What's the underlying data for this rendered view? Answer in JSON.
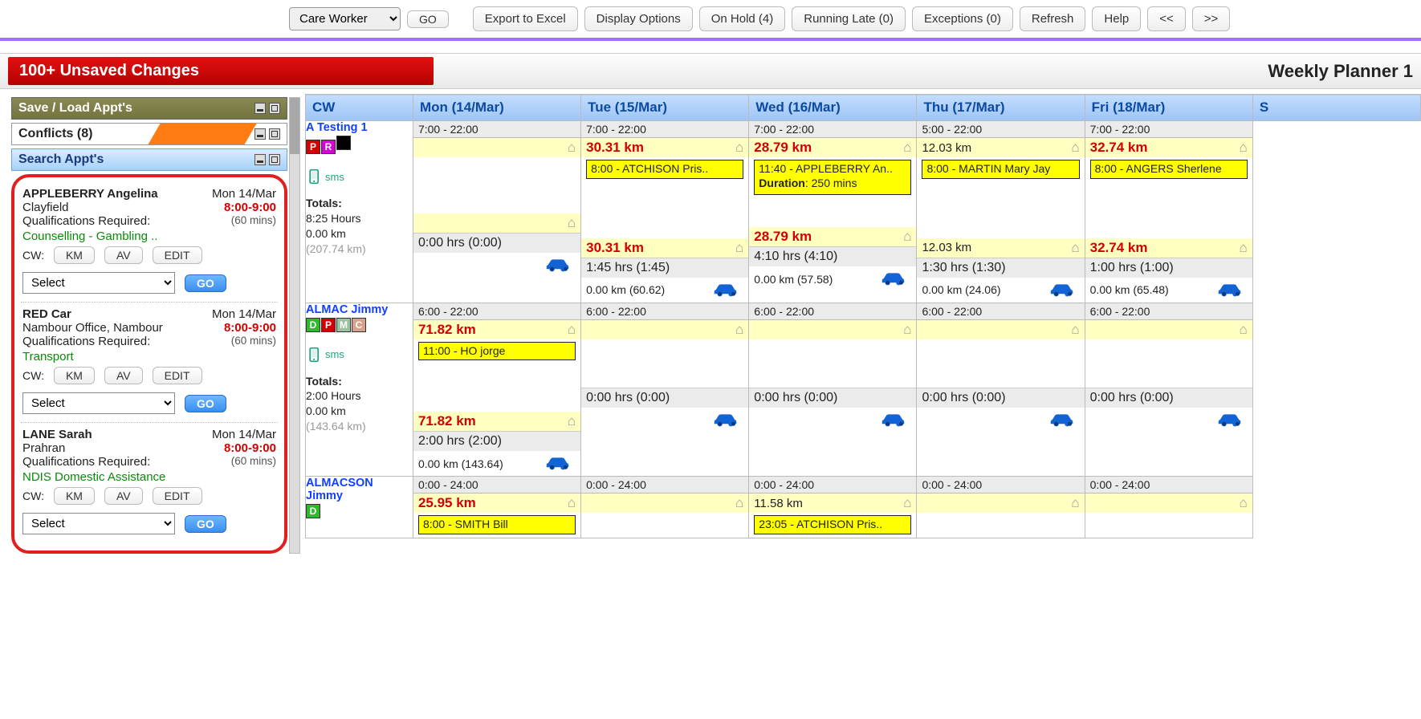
{
  "toolbar": {
    "filter_select": "Care Worker",
    "go": "GO",
    "export": "Export to Excel",
    "display_options": "Display Options",
    "on_hold": "On Hold (4)",
    "running_late": "Running Late (0)",
    "exceptions": "Exceptions (0)",
    "refresh": "Refresh",
    "help": "Help",
    "prev": "<<",
    "next": ">>"
  },
  "banner": "100+ Unsaved Changes",
  "page_title": "Weekly Planner   1",
  "panels": {
    "save_load": "Save / Load Appt's",
    "conflicts": "Conflicts (8)",
    "search": "Search Appt's"
  },
  "cards": [
    {
      "name": "APPLEBERRY Angelina",
      "date": "Mon 14/Mar",
      "loc": "Clayfield",
      "time": "8:00-9:00",
      "qual": "Qualifications Required:",
      "dur": "(60 mins)",
      "service": "Counselling - Gambling ..",
      "cw": "CW:",
      "km": "KM",
      "av": "AV",
      "edit": "EDIT",
      "select": "Select",
      "go": "GO"
    },
    {
      "name": "RED Car",
      "date": "Mon 14/Mar",
      "loc": "Nambour Office, Nambour",
      "time": "8:00-9:00",
      "qual": "Qualifications Required:",
      "dur": "(60 mins)",
      "service": "Transport",
      "cw": "CW:",
      "km": "KM",
      "av": "AV",
      "edit": "EDIT",
      "select": "Select",
      "go": "GO"
    },
    {
      "name": "LANE Sarah",
      "date": "Mon 14/Mar",
      "loc": "Prahran",
      "time": "8:00-9:00",
      "qual": "Qualifications Required:",
      "dur": "(60 mins)",
      "service": "NDIS Domestic Assistance",
      "cw": "CW:",
      "km": "KM",
      "av": "AV",
      "edit": "EDIT",
      "select": "Select",
      "go": "GO"
    }
  ],
  "grid": {
    "head_cw": "CW",
    "days": [
      "Mon (14/Mar)",
      "Tue (15/Mar)",
      "Wed (16/Mar)",
      "Thu (17/Mar)",
      "Fri (18/Mar)",
      "S"
    ],
    "rows": [
      {
        "cw": {
          "name": "A Testing 1",
          "badges": [
            {
              "t": "P",
              "c": "#d40000"
            },
            {
              "t": "R",
              "c": "#d900d9"
            },
            {
              "t": "",
              "c": "#000000"
            }
          ],
          "sms": "sms",
          "totals_label": "Totals:",
          "t_hours": "8:25 Hours",
          "t_km": "0.00 km",
          "t_tkm": "(207.74 km)"
        },
        "days": [
          {
            "shift": "7:00 - 22:00",
            "km": "",
            "km_red": false,
            "appt": null,
            "hrs": "0:00 hrs (0:00)",
            "bkm": "",
            "car": true
          },
          {
            "shift": "7:00 - 22:00",
            "km": "30.31 km",
            "km_red": true,
            "appt": {
              "text": "8:00 - ATCHISON Pris.."
            },
            "hrs": "1:45 hrs (1:45)",
            "bkm": "0.00 km (60.62)",
            "car": true,
            "km2": "30.31 km",
            "km2_red": true
          },
          {
            "shift": "7:00 - 22:00",
            "km": "28.79 km",
            "km_red": true,
            "appt": {
              "text": "11:40 - APPLEBERRY An..",
              "extra": "Duration: 250 mins",
              "tall": true
            },
            "hrs": "4:10 hrs (4:10)",
            "bkm": "0.00 km (57.58)",
            "car": true,
            "km2": "28.79 km",
            "km2_red": true
          },
          {
            "shift": "5:00 - 22:00",
            "km": "12.03 km",
            "km_red": false,
            "appt": {
              "text": "8:00 - MARTIN Mary Jay"
            },
            "hrs": "1:30 hrs (1:30)",
            "bkm": "0.00 km (24.06)",
            "car": true,
            "km2": "12.03 km",
            "km2_red": false
          },
          {
            "shift": "7:00 - 22:00",
            "km": "32.74 km",
            "km_red": true,
            "appt": {
              "text": "8:00 - ANGERS Sherlene"
            },
            "hrs": "1:00 hrs (1:00)",
            "bkm": "0.00 km (65.48)",
            "car": true,
            "km2": "32.74 km",
            "km2_red": true
          }
        ]
      },
      {
        "cw": {
          "name": "ALMAC Jimmy",
          "badges": [
            {
              "t": "D",
              "c": "#2dbb2d"
            },
            {
              "t": "P",
              "c": "#d40000"
            },
            {
              "t": "M",
              "c": "#9cc3a0"
            },
            {
              "t": "C",
              "c": "#d6a28a"
            }
          ],
          "sms": "sms",
          "totals_label": "Totals:",
          "t_hours": "2:00 Hours",
          "t_km": "0.00 km",
          "t_tkm": "(143.64 km)"
        },
        "days": [
          {
            "shift": "6:00 - 22:00",
            "km": "71.82 km",
            "km_red": true,
            "appt": {
              "text": "11:00 - HO jorge"
            },
            "hrs": "2:00 hrs (2:00)",
            "bkm": "0.00 km (143.64)",
            "car": true,
            "km2": "71.82 km",
            "km2_red": true
          },
          {
            "shift": "6:00 - 22:00",
            "km": "",
            "km_red": false,
            "appt": null,
            "hrs": "0:00 hrs (0:00)",
            "bkm": "",
            "car": true
          },
          {
            "shift": "6:00 - 22:00",
            "km": "",
            "km_red": false,
            "appt": null,
            "hrs": "0:00 hrs (0:00)",
            "bkm": "",
            "car": true
          },
          {
            "shift": "6:00 - 22:00",
            "km": "",
            "km_red": false,
            "appt": null,
            "hrs": "0:00 hrs (0:00)",
            "bkm": "",
            "car": true
          },
          {
            "shift": "6:00 - 22:00",
            "km": "",
            "km_red": false,
            "appt": null,
            "hrs": "0:00 hrs (0:00)",
            "bkm": "",
            "car": true
          }
        ]
      },
      {
        "cw": {
          "name": "ALMACSON Jimmy",
          "badges": [
            {
              "t": "D",
              "c": "#2dbb2d"
            }
          ]
        },
        "days": [
          {
            "shift": "0:00 - 24:00",
            "km": "25.95 km",
            "km_red": true,
            "appt": {
              "text": "8:00 - SMITH Bill"
            }
          },
          {
            "shift": "0:00 - 24:00",
            "km": "",
            "km_red": false,
            "appt": null
          },
          {
            "shift": "0:00 - 24:00",
            "km": "11.58 km",
            "km_red": false,
            "appt": {
              "text": "23:05 - ATCHISON Pris.."
            }
          },
          {
            "shift": "0:00 - 24:00",
            "km": "",
            "km_red": false,
            "appt": null
          },
          {
            "shift": "0:00 - 24:00",
            "km": "",
            "km_red": false,
            "appt": null
          }
        ]
      }
    ]
  },
  "labels": {
    "duration_prefix": "Duration"
  }
}
